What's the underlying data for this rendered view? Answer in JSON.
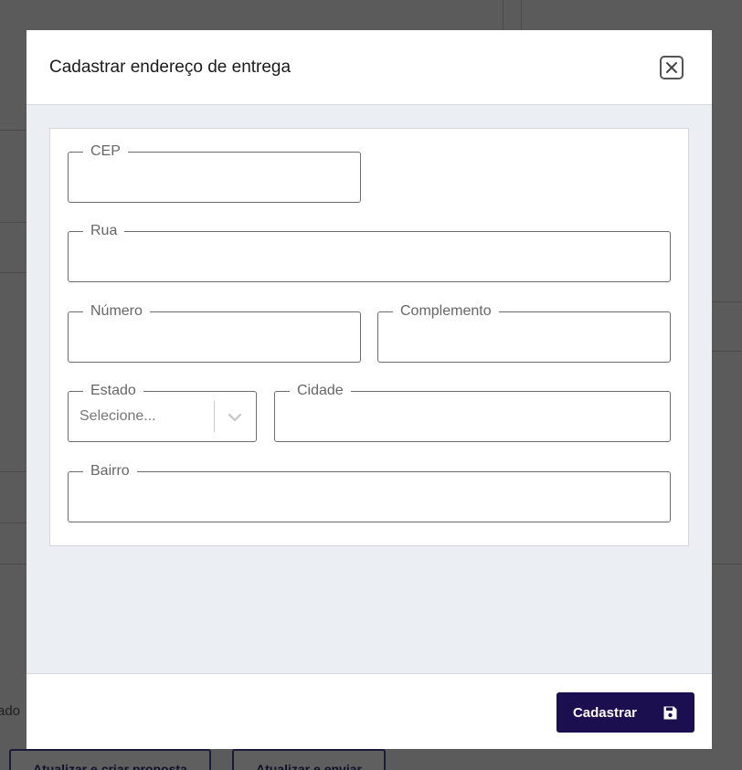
{
  "background": {
    "partial_text": "rado",
    "buttons": [
      "Atualizar e criar proposta",
      "Atualizar e enviar"
    ]
  },
  "modal": {
    "title": "Cadastrar endereço de entrega",
    "close_icon": "close-icon",
    "fields": {
      "cep": {
        "label": "CEP",
        "value": ""
      },
      "rua": {
        "label": "Rua",
        "value": ""
      },
      "numero": {
        "label": "Número",
        "value": ""
      },
      "complemento": {
        "label": "Complemento",
        "value": ""
      },
      "estado": {
        "label": "Estado",
        "placeholder": "Selecione..."
      },
      "cidade": {
        "label": "Cidade",
        "value": ""
      },
      "bairro": {
        "label": "Bairro",
        "value": ""
      }
    },
    "submit": {
      "label": "Cadastrar",
      "icon": "save-icon"
    }
  },
  "colors": {
    "primary": "#1c0f50",
    "overlay": "#5b5b5b",
    "body_bg": "#ebeef3"
  }
}
